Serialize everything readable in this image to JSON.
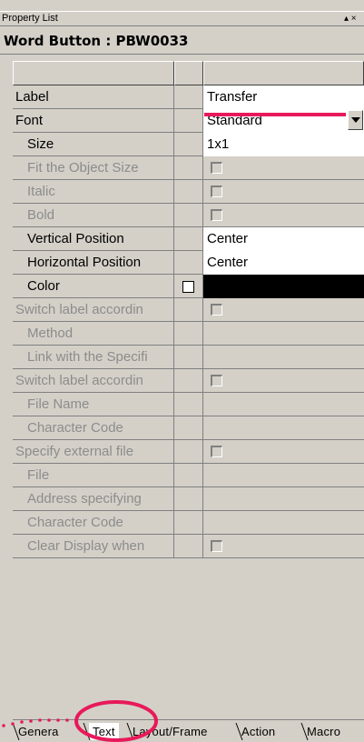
{
  "window": {
    "title": "Property List",
    "controls": "▴ ×"
  },
  "header": {
    "object_title": "Word Button : PBW0033"
  },
  "properties": [
    {
      "label": "Label",
      "value": "Transfer",
      "enabled": true,
      "indent": false,
      "value_style": "white",
      "widget": "none"
    },
    {
      "label": "Font",
      "value": "Standard",
      "enabled": true,
      "indent": false,
      "value_style": "white",
      "widget": "dropdown"
    },
    {
      "label": "Size",
      "value": "1x1",
      "enabled": true,
      "indent": true,
      "value_style": "white",
      "widget": "none"
    },
    {
      "label": "Fit the Object Size",
      "value": "",
      "enabled": false,
      "indent": true,
      "value_style": "gray",
      "widget": "checkbox"
    },
    {
      "label": "Italic",
      "value": "",
      "enabled": false,
      "indent": true,
      "value_style": "gray",
      "widget": "checkbox"
    },
    {
      "label": "Bold",
      "value": "",
      "enabled": false,
      "indent": true,
      "value_style": "gray",
      "widget": "checkbox"
    },
    {
      "label": "Vertical Position",
      "value": "Center",
      "enabled": true,
      "indent": true,
      "value_style": "white",
      "widget": "none"
    },
    {
      "label": "Horizontal Position",
      "value": "Center",
      "enabled": true,
      "indent": true,
      "value_style": "white",
      "widget": "none"
    },
    {
      "label": "Color",
      "value": "",
      "enabled": true,
      "indent": true,
      "value_style": "black",
      "widget": "mid-checkbox"
    },
    {
      "label": "Switch label accordin",
      "value": "",
      "enabled": false,
      "indent": false,
      "value_style": "gray",
      "widget": "checkbox"
    },
    {
      "label": "Method",
      "value": "",
      "enabled": false,
      "indent": true,
      "value_style": "gray",
      "widget": "none"
    },
    {
      "label": "Link with the Specifi",
      "value": "",
      "enabled": false,
      "indent": true,
      "value_style": "gray",
      "widget": "none"
    },
    {
      "label": "Switch label accordin",
      "value": "",
      "enabled": false,
      "indent": false,
      "value_style": "gray",
      "widget": "checkbox"
    },
    {
      "label": "File Name",
      "value": "",
      "enabled": false,
      "indent": true,
      "value_style": "gray",
      "widget": "none"
    },
    {
      "label": "Character Code",
      "value": "",
      "enabled": false,
      "indent": true,
      "value_style": "gray",
      "widget": "none"
    },
    {
      "label": "Specify external file",
      "value": "",
      "enabled": false,
      "indent": false,
      "value_style": "gray",
      "widget": "checkbox"
    },
    {
      "label": "File",
      "value": "",
      "enabled": false,
      "indent": true,
      "value_style": "gray",
      "widget": "none"
    },
    {
      "label": "Address specifying",
      "value": "",
      "enabled": false,
      "indent": true,
      "value_style": "gray",
      "widget": "none"
    },
    {
      "label": "Character Code",
      "value": "",
      "enabled": false,
      "indent": true,
      "value_style": "gray",
      "widget": "none"
    },
    {
      "label": "Clear Display when",
      "value": "",
      "enabled": false,
      "indent": true,
      "value_style": "gray",
      "widget": "checkbox"
    }
  ],
  "tabs": [
    {
      "label": "Genera",
      "active": false
    },
    {
      "label": "Text",
      "active": true
    },
    {
      "label": "Layout/Frame",
      "active": false
    },
    {
      "label": "Action",
      "active": false
    },
    {
      "label": "Macro",
      "active": false
    }
  ],
  "colors": {
    "panel_bg": "#d4d0c8",
    "annotation": "#e8195a",
    "disabled_text": "#8c8c8c"
  }
}
